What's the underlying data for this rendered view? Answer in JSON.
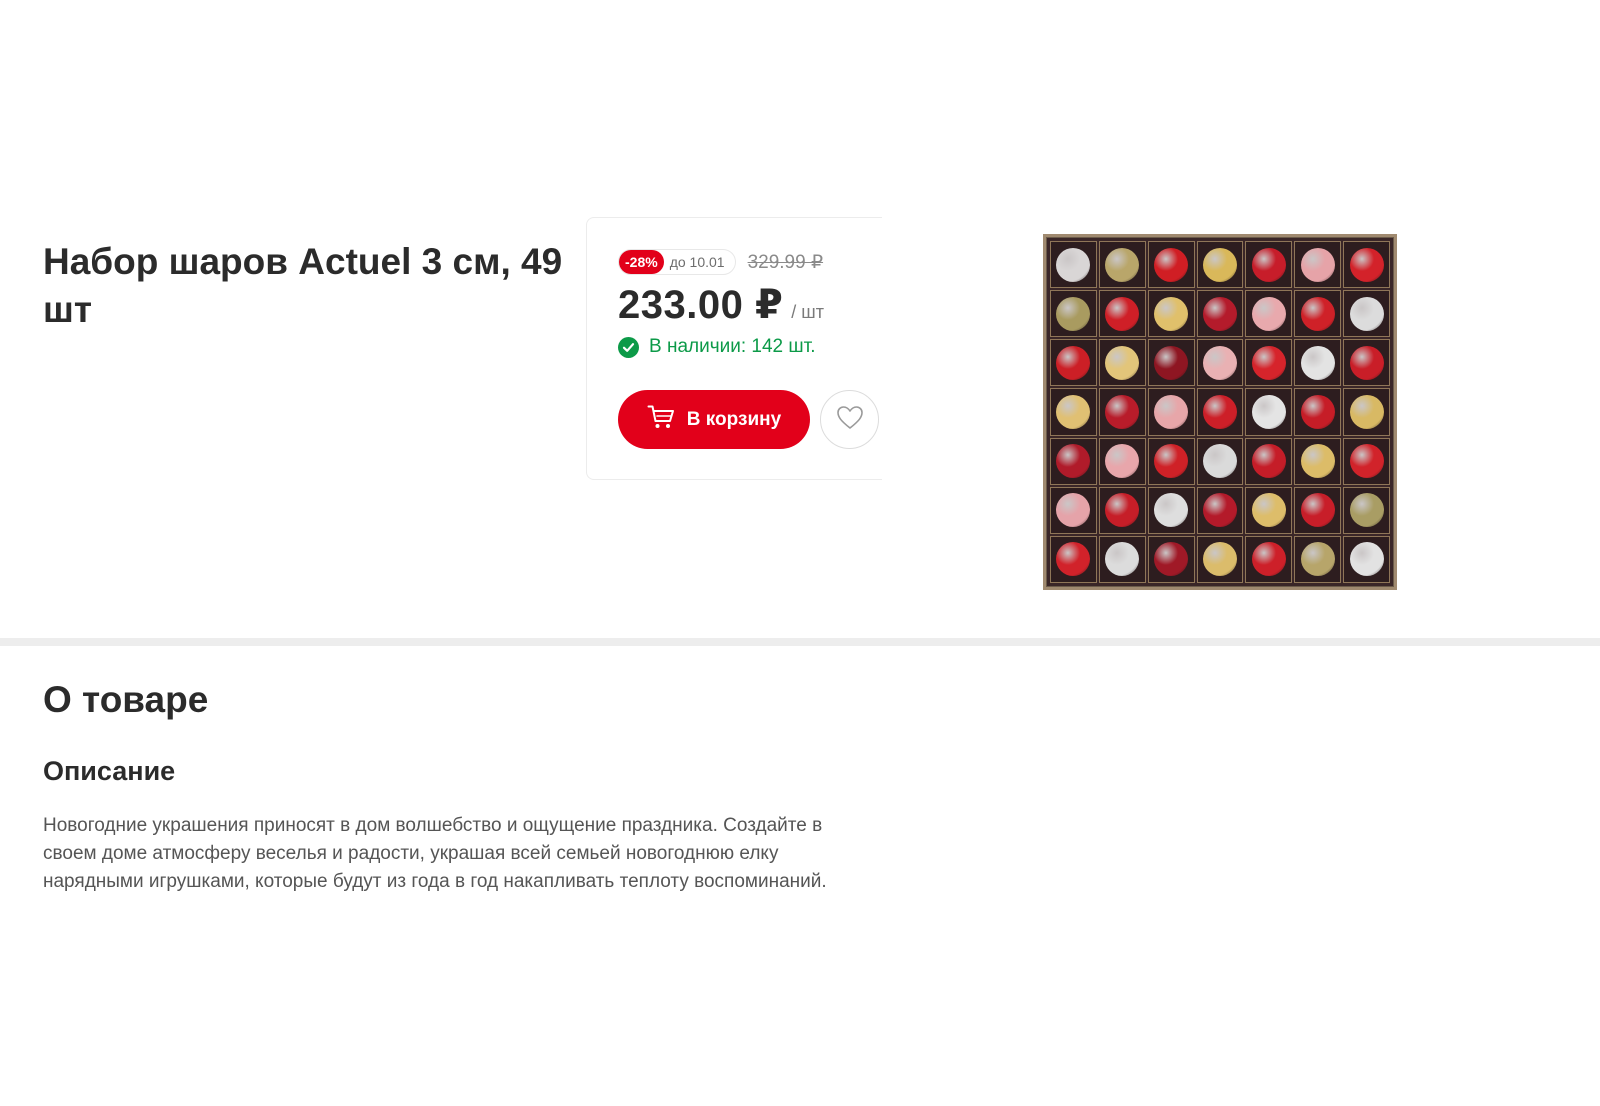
{
  "product": {
    "title": "Набор шаров Actuel 3 см, 49 шт"
  },
  "buy_box": {
    "discount_badge": "-28%",
    "promo_until": "до 10.01",
    "old_price": "329.99 ₽",
    "price": "233.00 ₽",
    "price_unit": "/ шт",
    "stock_status": "В наличии: 142 шт.",
    "cart_button_label": "В корзину"
  },
  "icons": {
    "stock": "check-circle-icon",
    "cart": "shopping-cart-icon",
    "favorite": "heart-icon"
  },
  "colors": {
    "brand_red": "#e2001a",
    "stock_green": "#0c9a48"
  },
  "image": {
    "ball_colors": [
      [
        "#d9d6d6",
        "#b9a66a",
        "#d01e24",
        "#d9b85a",
        "#c71d2a",
        "#e6a3a8",
        "#d3222a"
      ],
      [
        "#a99b60",
        "#cf1f27",
        "#e0c06b",
        "#b41b2b",
        "#e8a9ad",
        "#cf2128",
        "#dcdcdc"
      ],
      [
        "#cc1f26",
        "#e2c57a",
        "#8e1622",
        "#e9b1b3",
        "#d6242b",
        "#e3e3e3",
        "#c91e28"
      ],
      [
        "#e0c073",
        "#b81c2a",
        "#e7a6a9",
        "#cd1f28",
        "#e4e4e4",
        "#c61d27",
        "#d8b964"
      ],
      [
        "#b01b2a",
        "#e8a6ab",
        "#cf2127",
        "#dadada",
        "#c51d28",
        "#dcbc68",
        "#d1232a"
      ],
      [
        "#e5a3a9",
        "#c61e28",
        "#dedede",
        "#b41a2a",
        "#ddbd6a",
        "#c81e29",
        "#a99d64"
      ],
      [
        "#d1222a",
        "#dcdcdc",
        "#a01927",
        "#dbbc6b",
        "#cd2029",
        "#b7a56a",
        "#e2e2e2"
      ]
    ]
  },
  "about": {
    "section_title": "О товаре",
    "description_title": "Описание",
    "description_text": "Новогодние украшения приносят в дом волшебство и ощущение праздника. Создайте в своем доме атмосферу веселья и радости, украшая всей семьей новогоднюю елку нарядными игрушками, которые будут из года в год накапливать теплоту воспоминаний."
  }
}
